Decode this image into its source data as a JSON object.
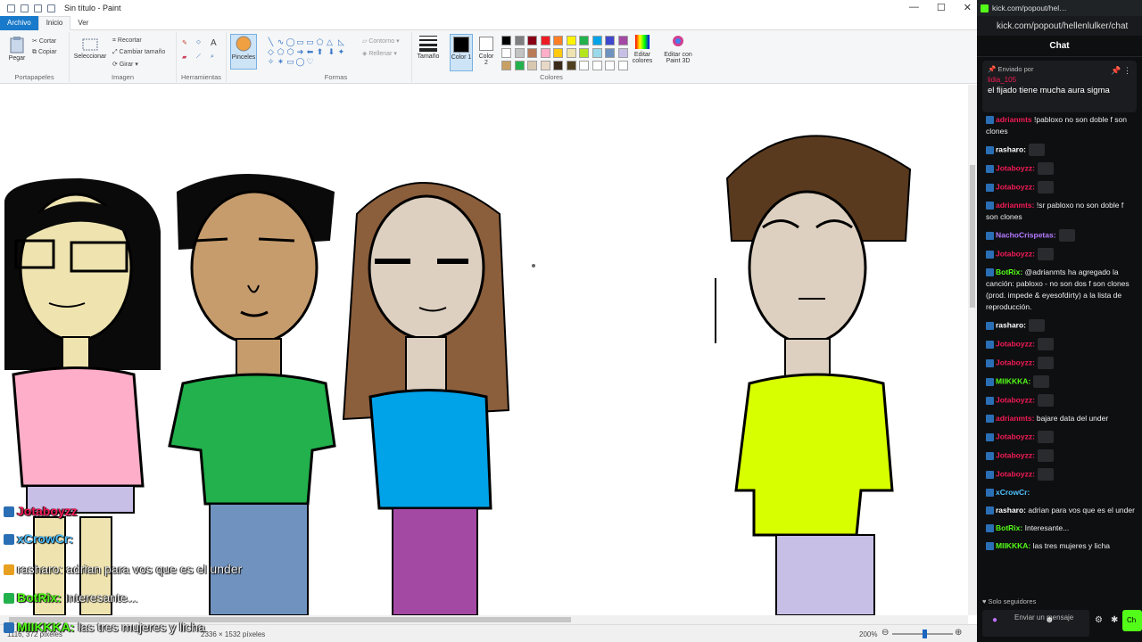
{
  "paint": {
    "title": "Sin título - Paint",
    "tabs": [
      "Archivo",
      "Inicio",
      "Ver"
    ],
    "ribbon": {
      "portapapeles": {
        "label": "Portapapeles",
        "pegar": "Pegar",
        "cortar": "Cortar",
        "copiar": "Copiar"
      },
      "imagen": {
        "label": "Imagen",
        "seleccionar": "Seleccionar",
        "recortar": "Recortar",
        "cambiar_tamano": "Cambiar tamaño",
        "girar": "Girar"
      },
      "herramientas": {
        "label": "Herramientas"
      },
      "pinceles": "Pinceles",
      "formas": {
        "label": "Formas",
        "contorno": "Contorno",
        "rellenar": "Rellenar"
      },
      "tamano": "Tamaño",
      "color1": "Color 1",
      "color2": "Color 2",
      "colores": {
        "label": "Colores",
        "editar": "Editar colores"
      },
      "paint3d": "Editar con Paint 3D"
    },
    "palette_row1": [
      "#000000",
      "#7f7f7f",
      "#880015",
      "#ed1c24",
      "#ff7f27",
      "#fff200",
      "#22b14c",
      "#00a2e8",
      "#3f48cc",
      "#a349a4"
    ],
    "palette_row2": [
      "#ffffff",
      "#c3c3c3",
      "#b97a57",
      "#ffaec9",
      "#ffc90e",
      "#efe4b0",
      "#b5e61d",
      "#99d9ea",
      "#7092be",
      "#c8bfe7"
    ],
    "palette_row3": [
      "#c8a064",
      "#22b14c",
      "#d8c8b0",
      "#e8d8c8",
      "#3a2a1a",
      "#504020",
      "#ffffff",
      "#ffffff",
      "#ffffff",
      "#ffffff"
    ],
    "status": {
      "pos": "1116, 372 píxeles",
      "size": "2336 × 1532 píxeles",
      "zoom": "200%"
    }
  },
  "overlay_chat": [
    {
      "user": "Jotaboyzz",
      "text": ""
    },
    {
      "user": "xCrowCr:",
      "text": ""
    },
    {
      "user": "rasharo:",
      "text": "adrian para vos que es el under"
    },
    {
      "user": "BotRix:",
      "text": "Interesante..."
    },
    {
      "user": "MIIKKKA:",
      "text": "las tres mujeres y licha"
    }
  ],
  "chat": {
    "browser_title": "kick.com/popout/hel…",
    "url": "kick.com/popout/hellenlulker/chat",
    "header": "Chat",
    "pinned": {
      "by": "Enviado por",
      "user": "lidia_105",
      "text": "el fijado tiene mucha aura sigma"
    },
    "messages": [
      {
        "user": "adrianmts",
        "text": "!pabloxo no son doble f son clones",
        "color": "red"
      },
      {
        "user": "rasharo:",
        "text": "",
        "color": "plain",
        "emote": true
      },
      {
        "user": "Jotaboyzz:",
        "text": "",
        "color": "red",
        "emote": true
      },
      {
        "user": "Jotaboyzz:",
        "text": "",
        "color": "red",
        "emote": true
      },
      {
        "user": "adrianmts:",
        "text": "!sr pabloxo no son doble f son clones",
        "color": "red"
      },
      {
        "user": "NachoCrispetas:",
        "text": "",
        "color": "purple",
        "emote": true
      },
      {
        "user": "Jotaboyzz:",
        "text": "",
        "color": "red",
        "emote": true
      },
      {
        "user": "BotRix:",
        "text": "@adrianmts ha agregado la canción: pabloxo - no son dos f son clones (prod. impede & eyesofdirty) a la lista de reproducción.",
        "color": "green"
      },
      {
        "user": "rasharo:",
        "text": "",
        "color": "plain",
        "emote": true
      },
      {
        "user": "Jotaboyzz:",
        "text": "",
        "color": "red",
        "emote": true
      },
      {
        "user": "Jotaboyzz:",
        "text": "",
        "color": "red",
        "emote": true
      },
      {
        "user": "MIIKKKA:",
        "text": "",
        "color": "green",
        "emote": true
      },
      {
        "user": "Jotaboyzz:",
        "text": "",
        "color": "red",
        "emote": true
      },
      {
        "user": "adrianmts:",
        "text": "bajare data del under",
        "color": "red"
      },
      {
        "user": "Jotaboyzz:",
        "text": "",
        "color": "red",
        "emote": true
      },
      {
        "user": "Jotaboyzz:",
        "text": "",
        "color": "red",
        "emote": true
      },
      {
        "user": "Jotaboyzz:",
        "text": "",
        "color": "red",
        "emote": true
      },
      {
        "user": "xCrowCr:",
        "text": "",
        "color": "blue"
      },
      {
        "user": "rasharo:",
        "text": "adrian para vos que es el under",
        "color": "plain"
      },
      {
        "user": "BotRix:",
        "text": "Interesante...",
        "color": "green"
      },
      {
        "user": "MIIKKKA:",
        "text": "las tres mujeres y licha",
        "color": "green"
      }
    ],
    "followers_only": "Solo seguidores",
    "input_placeholder": "Enviar un mensaje",
    "send": "Ch"
  }
}
